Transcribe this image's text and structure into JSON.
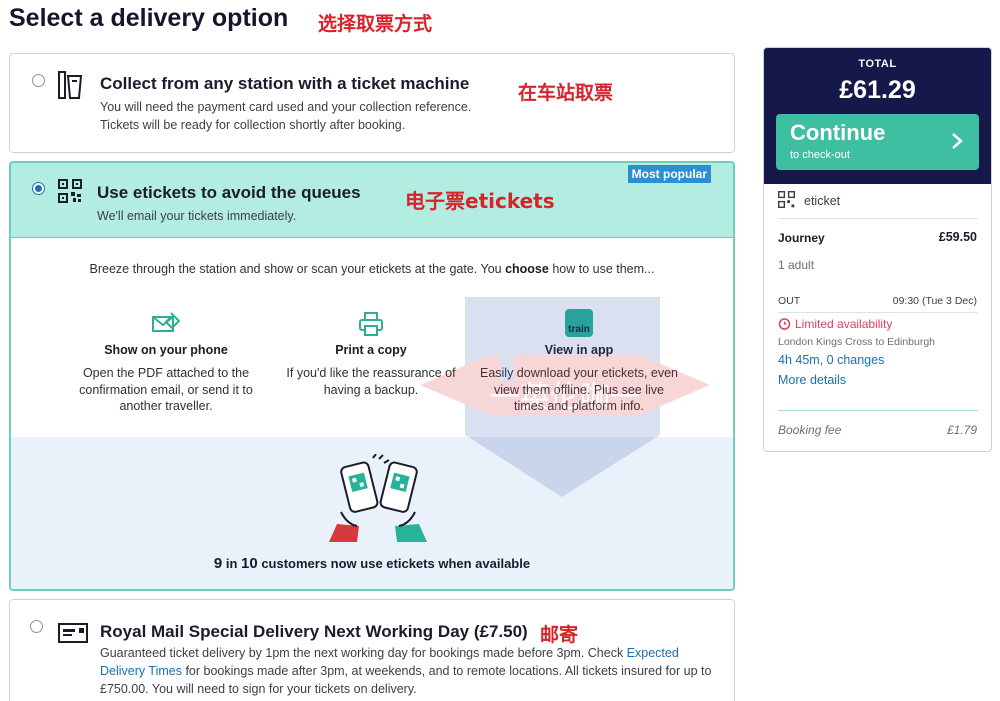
{
  "page": {
    "title": "Select a delivery option",
    "annotation": "选择取票方式"
  },
  "options": [
    {
      "title": "Collect from any station with a ticket machine",
      "desc1": "You will need the payment card used and your collection reference.",
      "desc2": "Tickets will be ready for collection shortly after booking.",
      "annotation": "在车站取票",
      "selected": false,
      "icon": "ticket-machine-icon"
    },
    {
      "title": "Use etickets to avoid the queues",
      "desc": "We'll email your tickets immediately.",
      "annotation": "电子票etickets",
      "badge": "Most popular",
      "selected": true,
      "icon": "qr-code-icon",
      "intro_prefix": "Breeze through the station and show or scan your etickets at the gate. You ",
      "intro_bold": "choose",
      "intro_suffix": " how to use them...",
      "features": [
        {
          "title": "Show on your phone",
          "desc": "Open the PDF attached to the confirmation email, or send it to another traveller.",
          "icon": "email-attachment-icon"
        },
        {
          "title": "Print a copy",
          "desc": "If you'd like the reassurance of having a backup.",
          "icon": "printer-icon"
        },
        {
          "title": "View in app",
          "desc": "Easily download your etickets, even view them offline. Plus see live times and platform info.",
          "icon": "train-app-icon",
          "icon_text": "train"
        }
      ],
      "stat_num1": "9",
      "stat_in": " in ",
      "stat_num2": "10",
      "stat_rest": " customers now use etickets when available"
    },
    {
      "title": "Royal Mail Special Delivery Next Working Day (£7.50)",
      "desc_part1": "Guaranteed ticket delivery by 1pm the next working day for bookings made before 3pm. Check ",
      "desc_link": "Expected Delivery Times",
      "desc_part2": " for bookings made after 3pm, at weekends, and to remote locations. All tickets insured for up to £750.00. You will need to sign for your tickets on delivery.",
      "annotation": "邮寄",
      "selected": false,
      "icon": "envelope-icon"
    }
  ],
  "watermark": {
    "text": "一英伦咖一"
  },
  "summary": {
    "total_label": "TOTAL",
    "total": "£61.29",
    "continue_label": "Continue",
    "continue_sub": "to check-out",
    "delivery_type": "eticket",
    "journey_label": "Journey",
    "journey_price": "£59.50",
    "passengers": "1 adult",
    "out_label": "OUT",
    "out_time": "09:30 (Tue 3 Dec)",
    "availability": "Limited availability",
    "route": "London Kings Cross to Edinburgh",
    "duration": "4h 45m, 0 changes",
    "more_details": "More details",
    "fee_label": "Booking fee",
    "fee_value": "£1.79"
  },
  "colors": {
    "accent": "#3fbfa1",
    "navy": "#14194a",
    "selected_bg": "#b3ece1",
    "link": "#1a6fb0",
    "warning": "#d9425b",
    "badge": "#2d8fd3"
  }
}
